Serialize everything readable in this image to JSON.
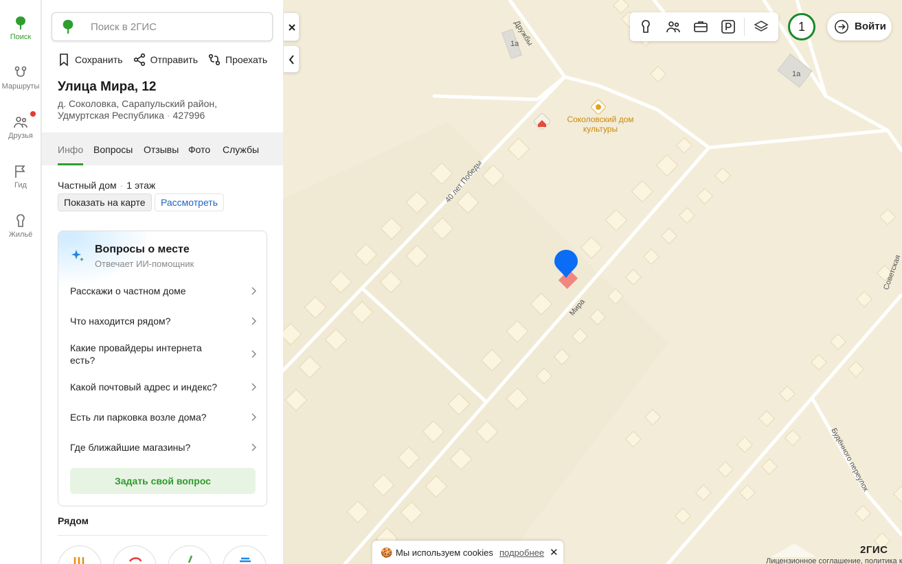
{
  "rail": {
    "items": [
      {
        "label": "Поиск",
        "icon": "tree-icon",
        "active": true
      },
      {
        "label": "Маршруты",
        "icon": "route-icon"
      },
      {
        "label": "Друзья",
        "icon": "friends-icon",
        "badge": true
      },
      {
        "label": "Гид",
        "icon": "flag-icon"
      },
      {
        "label": "Жильё",
        "icon": "house-icon"
      }
    ]
  },
  "search": {
    "placeholder": "Поиск в 2ГИС"
  },
  "actions": {
    "save": "Сохранить",
    "share": "Отправить",
    "route": "Проехать"
  },
  "place": {
    "title": "Улица Мира, 12",
    "address_line1": "д. Соколовка, Сарапульский район,",
    "address_line2": "Удмуртская Республика",
    "postcode": "427996",
    "type": "Частный дом",
    "floors": "1 этаж",
    "show_on_map": "Показать на карте",
    "view": "Рассмотреть"
  },
  "tabs": [
    "Инфо",
    "Вопросы",
    "Отзывы",
    "Фото",
    "Службы"
  ],
  "qa": {
    "title": "Вопросы о месте",
    "subtitle": "Отвечает ИИ-помощник",
    "questions": [
      "Расскажи о частном доме",
      "Что находится рядом?",
      "Какие провайдеры интернета есть?",
      "Какой почтовый адрес и индекс?",
      "Есть ли парковка возле дома?",
      "Где ближайшие магазины?"
    ],
    "ask_button": "Задать свой вопрос"
  },
  "nearby": {
    "title": "Рядом"
  },
  "map": {
    "notification_count": "1",
    "login": "Войти",
    "poi_name": "Соколовский дом культуры",
    "streets": [
      "Дружбы",
      "40 лет Победы",
      "Мира",
      "Советская",
      "Будённого переулок"
    ],
    "house_number": "1а",
    "cookie_text": "Мы используем cookies",
    "cookie_more": "подробнее",
    "brand": "2ГИС",
    "legal": "Лицензионное соглашение, политика конфиденциальности"
  },
  "colors": {
    "accent_green": "#2f9e2f",
    "link_blue": "#1f64c7",
    "marker_blue": "#0b6cf5",
    "map_bg": "#f3ecd8"
  }
}
